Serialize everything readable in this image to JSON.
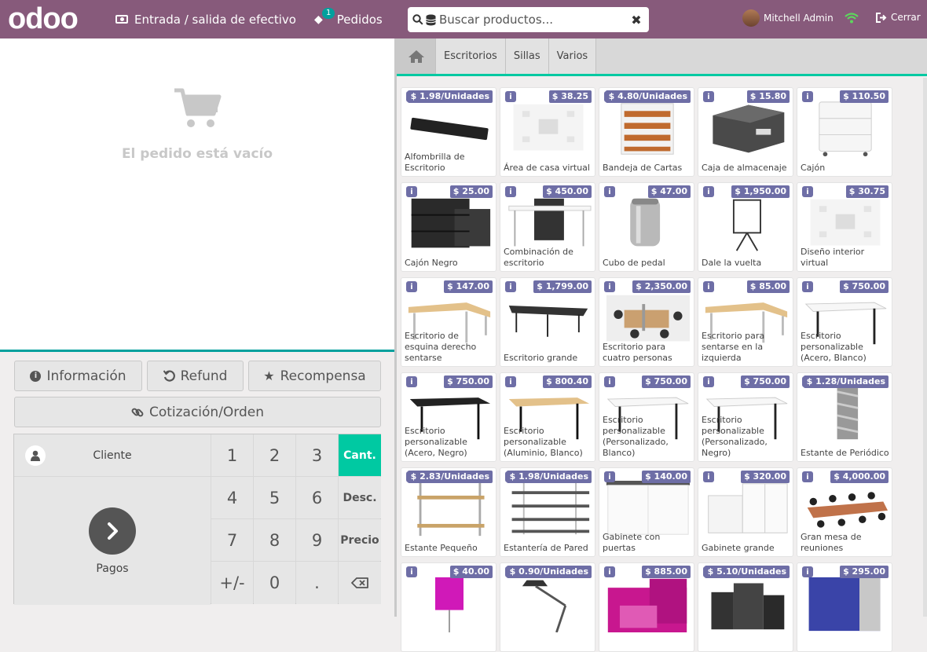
{
  "topbar": {
    "logo": "odoo",
    "cash_label": "Entrada / salida de efectivo",
    "orders_label": "Pedidos",
    "orders_count": "1",
    "search_placeholder": "Buscar productos...",
    "user_name": "Mitchell Admin",
    "close_label": "Cerrar"
  },
  "order": {
    "empty_text": "El pedido está vacío"
  },
  "controls": {
    "info_label": "Información",
    "refund_label": "Refund",
    "reward_label": "Recompensa",
    "quote_label": "Cotización/Orden"
  },
  "pad": {
    "client_label": "Cliente",
    "payment_label": "Pagos",
    "keys": [
      "1",
      "2",
      "3",
      "4",
      "5",
      "6",
      "7",
      "8",
      "9",
      "+/-",
      "0",
      "."
    ],
    "modes": [
      "Cant.",
      "Desc.",
      "Precio"
    ],
    "active_mode": "Cant."
  },
  "categories": [
    "Escritorios",
    "Sillas",
    "Varios"
  ],
  "products": [
    {
      "name": "Alfombrilla de Escritorio",
      "price": "$ 1.98/Unidades",
      "kind": "mat"
    },
    {
      "name": "Área de casa virtual",
      "price": "$ 38.25",
      "kind": "virtual"
    },
    {
      "name": "Bandeja de Cartas",
      "price": "$ 4.80/Unidades",
      "kind": "tray"
    },
    {
      "name": "Caja de almacenaje",
      "price": "$ 15.80",
      "kind": "box"
    },
    {
      "name": "Cajón",
      "price": "$ 110.50",
      "kind": "drawer"
    },
    {
      "name": "Cajón Negro",
      "price": "$ 25.00",
      "kind": "blackdrawer"
    },
    {
      "name": "Combinación de escritorio",
      "price": "$ 450.00",
      "kind": "combo"
    },
    {
      "name": "Cubo de pedal",
      "price": "$ 47.00",
      "kind": "bin"
    },
    {
      "name": "Dale la vuelta",
      "price": "$ 1,950.00",
      "kind": "flip"
    },
    {
      "name": "Diseño interior virtual",
      "price": "$ 30.75",
      "kind": "virtual"
    },
    {
      "name": "Escritorio de esquina derecho sentarse",
      "price": "$ 147.00",
      "kind": "cornerdesk"
    },
    {
      "name": "Escritorio grande",
      "price": "$ 1,799.00",
      "kind": "bigdesk"
    },
    {
      "name": "Escritorio para cuatro personas",
      "price": "$ 2,350.00",
      "kind": "four"
    },
    {
      "name": "Escritorio para sentarse en la izquierda",
      "price": "$ 85.00",
      "kind": "cornerdesk"
    },
    {
      "name": "Escritorio personalizable (Acero, Blanco)",
      "price": "$ 750.00",
      "kind": "whitedesk"
    },
    {
      "name": "Escritorio personalizable (Acero, Negro)",
      "price": "$ 750.00",
      "kind": "blackdesk"
    },
    {
      "name": "Escritorio personalizable (Aluminio, Blanco)",
      "price": "$ 800.40",
      "kind": "wooddesk"
    },
    {
      "name": "Escritorio personalizable (Personalizado, Blanco)",
      "price": "$ 750.00",
      "kind": "whitedesk"
    },
    {
      "name": "Escritorio personalizable (Personalizado, Negro)",
      "price": "$ 750.00",
      "kind": "whitedesk"
    },
    {
      "name": "Estante de Periódico",
      "price": "$ 1.28/Unidades",
      "kind": "magrack"
    },
    {
      "name": "Estante Pequeño",
      "price": "$ 2.83/Unidades",
      "kind": "shelf"
    },
    {
      "name": "Estantería de Pared",
      "price": "$ 1.98/Unidades",
      "kind": "wallshelf"
    },
    {
      "name": "Gabinete con puertas",
      "price": "$ 140.00",
      "kind": "cabinet"
    },
    {
      "name": "Gabinete grande",
      "price": "$ 320.00",
      "kind": "bigcabinet"
    },
    {
      "name": "Gran mesa de reuniones",
      "price": "$ 4,000.00",
      "kind": "meeting"
    },
    {
      "name": "",
      "price": "$ 40.00",
      "kind": "lamp"
    },
    {
      "name": "",
      "price": "$ 0.90/Unidades",
      "kind": "desklamp"
    },
    {
      "name": "",
      "price": "$ 885.00",
      "kind": "pinkchair"
    },
    {
      "name": "",
      "price": "$ 5.10/Unidades",
      "kind": "organizer"
    },
    {
      "name": "",
      "price": "$ 295.00",
      "kind": "panel"
    }
  ]
}
